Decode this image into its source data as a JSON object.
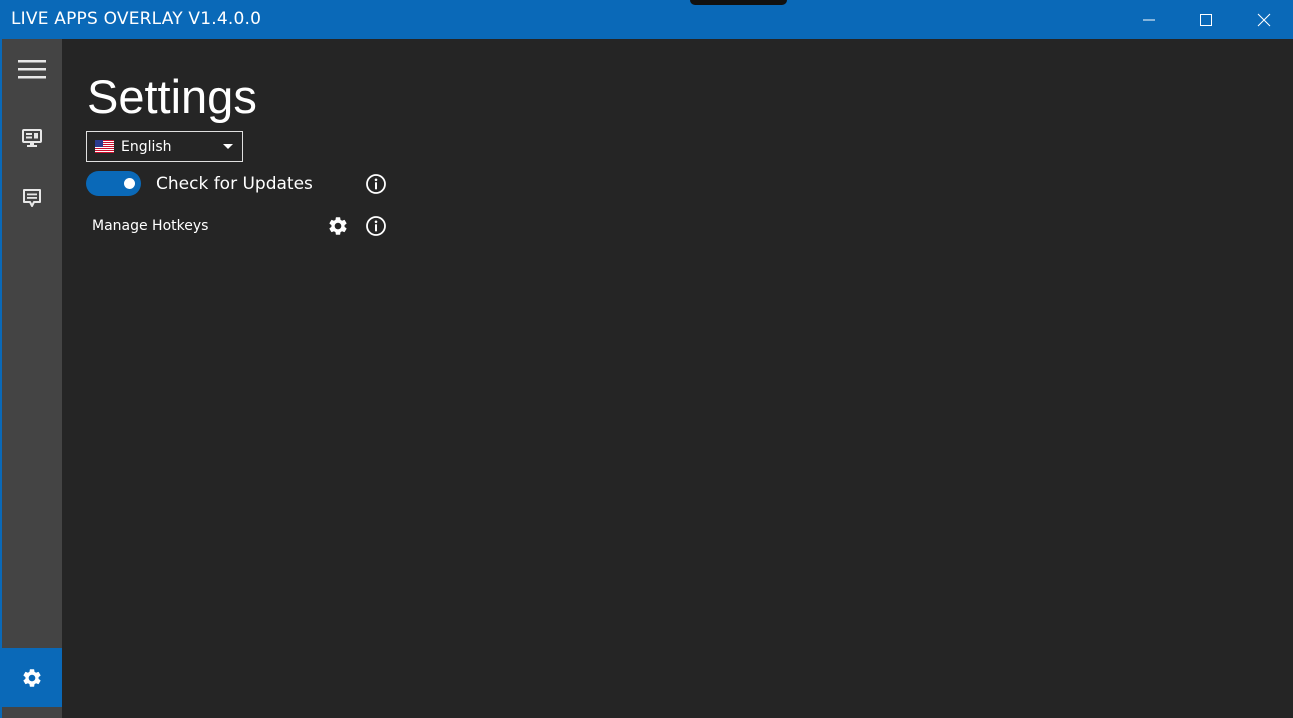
{
  "window": {
    "title": "LIVE APPS OVERLAY V1.4.0.0",
    "accent_color": "#0a69b8",
    "controls": [
      "minimize-icon",
      "maximize-icon",
      "close-icon"
    ]
  },
  "sidebar": {
    "items": [
      {
        "name": "menu",
        "icon": "hamburger-menu-icon",
        "active": false
      },
      {
        "name": "overlay",
        "icon": "monitor-icon",
        "active": false
      },
      {
        "name": "chat",
        "icon": "chat-icon",
        "active": false
      },
      {
        "name": "settings",
        "icon": "gear-icon",
        "active": true
      }
    ]
  },
  "main": {
    "title": "Settings",
    "language": {
      "selected": "English",
      "flag_icon": "us-flag-icon"
    },
    "check_updates": {
      "label": "Check for Updates",
      "enabled": true
    },
    "hotkeys": {
      "label": "Manage Hotkeys"
    }
  }
}
